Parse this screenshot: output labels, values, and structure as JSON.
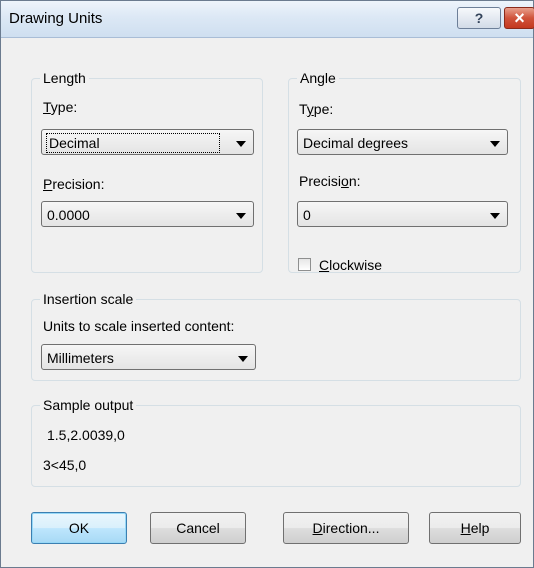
{
  "window": {
    "title": "Drawing Units",
    "help_icon": "?",
    "close_icon": "×"
  },
  "length": {
    "legend": "Length",
    "type_label": "Type:",
    "type_value": "Decimal",
    "precision_label": "Precision:",
    "precision_value": "0.0000"
  },
  "angle": {
    "legend": "Angle",
    "type_label": "Type:",
    "type_value": "Decimal degrees",
    "precision_label": "Precision:",
    "precision_value": "0",
    "clockwise_label": "Clockwise",
    "clockwise_checked": false
  },
  "insertion": {
    "legend": "Insertion scale",
    "units_label": "Units to scale inserted content:",
    "units_value": "Millimeters"
  },
  "sample": {
    "legend": "Sample output",
    "line1": "1.5,2.0039,0",
    "line2": "3<45,0"
  },
  "buttons": {
    "ok": "OK",
    "cancel": "Cancel",
    "direction": "Direction...",
    "help": "Help"
  }
}
